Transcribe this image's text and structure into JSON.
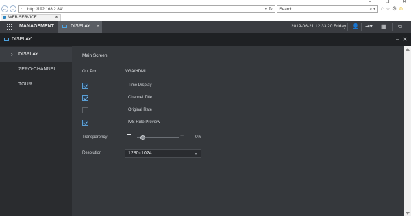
{
  "browser": {
    "url": "http://192.168.2.84/",
    "search_placeholder": "Search...",
    "tab_title": "WEB SERVICE",
    "window_controls": [
      "–",
      "❐",
      "✕"
    ]
  },
  "header": {
    "management_label": "MANAGEMENT",
    "display_tab_label": "DISPLAY",
    "datetime": "2019-06-21 12:33:20 Friday"
  },
  "panel": {
    "title": "DISPLAY"
  },
  "sidebar": {
    "items": [
      {
        "label": "DISPLAY",
        "active": true
      },
      {
        "label": "ZERO-CHANNEL",
        "active": false
      },
      {
        "label": "TOUR",
        "active": false
      }
    ]
  },
  "main": {
    "section_title": "Main Screen",
    "out_port_label": "Out Port",
    "out_port_value": "VGA/HDMI",
    "options": [
      {
        "label": "Time Display",
        "checked": true
      },
      {
        "label": "Channel Title",
        "checked": true
      },
      {
        "label": "Original Rate",
        "checked": false
      },
      {
        "label": "IVS Rule Preview",
        "checked": true
      }
    ],
    "transparency_label": "Transparency",
    "transparency_value": 0,
    "transparency_text": "0%",
    "resolution_label": "Resolution",
    "resolution_value": "1280x1024"
  },
  "colors": {
    "accent": "#4da3e0",
    "header_bg": "#3a3c41",
    "panel_bg": "#35383c",
    "sidebar_bg": "#2a2c2f"
  }
}
